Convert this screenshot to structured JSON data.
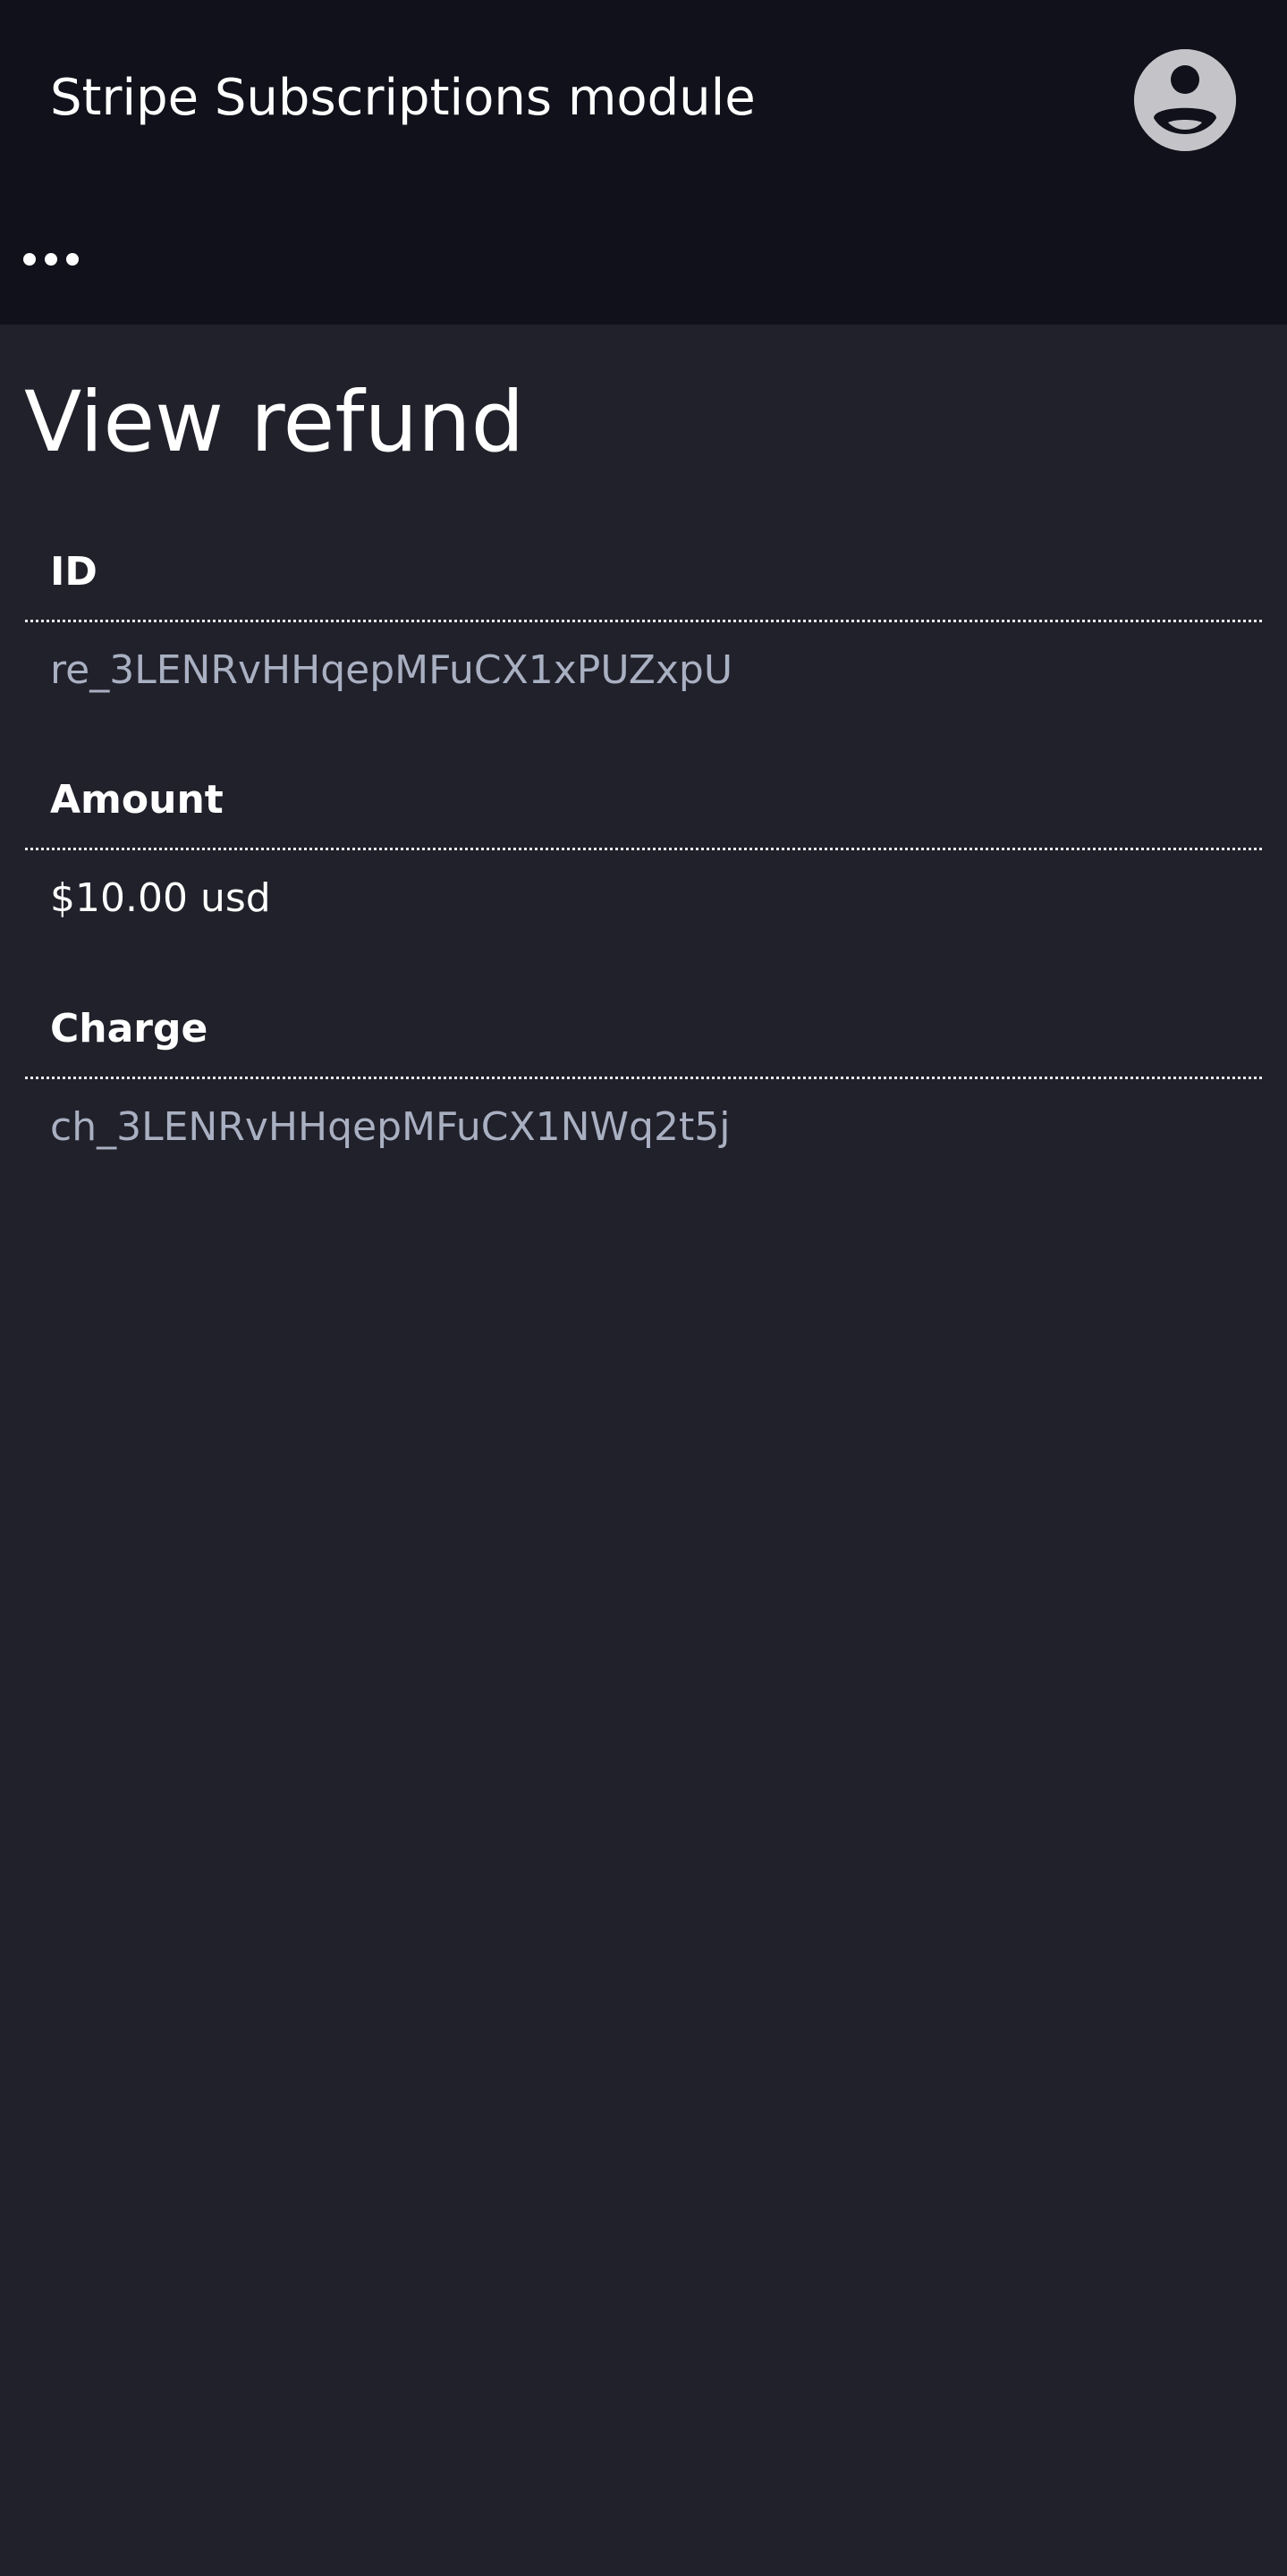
{
  "header": {
    "app_title": "Stripe Subscriptions module",
    "avatar_icon": "user-circle-icon",
    "more_icon": "ellipsis-icon"
  },
  "page": {
    "title": "View refund"
  },
  "fields": [
    {
      "label": "ID",
      "value": "re_3LENRvHHqepMFuCX1xPUZxpU",
      "value_color": "#a9b0c2"
    },
    {
      "label": "Amount",
      "value": "$10.00 usd",
      "value_color": "#ffffff"
    },
    {
      "label": "Charge",
      "value": "ch_3LENRvHHqepMFuCX1NWq2t5j",
      "value_color": "#a9b0c2"
    }
  ],
  "colors": {
    "header_bg": "#10111a",
    "page_bg": "#21212b",
    "avatar": "#c4c4c8"
  }
}
